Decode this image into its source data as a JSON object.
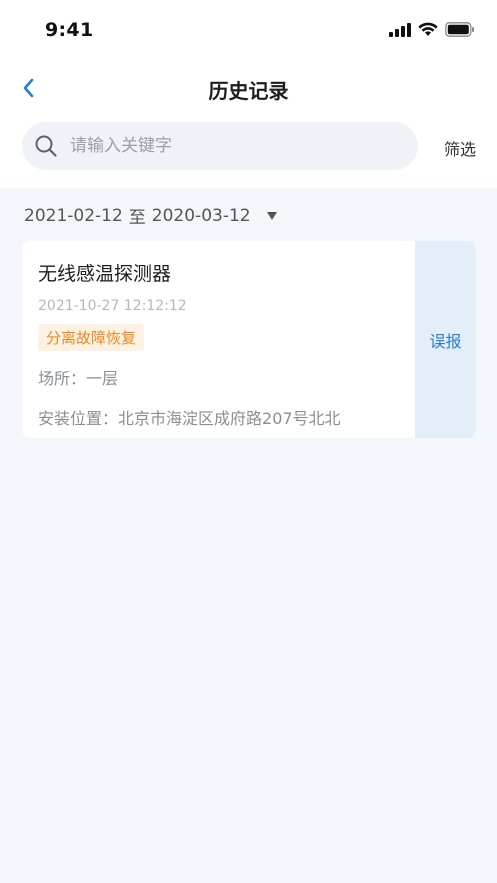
{
  "status_bar": {
    "time": "9:41"
  },
  "nav": {
    "title": "历史记录"
  },
  "search": {
    "placeholder": "请输入关键字",
    "value": ""
  },
  "filter": {
    "label": "筛选"
  },
  "date_range": {
    "start": "2021-02-12",
    "separator": "至",
    "end": "2020-03-12"
  },
  "records": [
    {
      "device_name": "无线感温探测器",
      "time": "2021-10-27 12:12:12",
      "status": "分离故障恢复",
      "place_label": "场所：",
      "place": "一层",
      "address_label": "安装位置：",
      "address": "北京市海淀区成府路207号北北",
      "action_label": "误报"
    }
  ],
  "colors": {
    "accent": "#2b7cd3",
    "badge_text": "#ef8a20",
    "badge_bg": "#fdf1e3",
    "page_bg": "#f3f6fa",
    "action_bg": "#e4eef9"
  },
  "icons": [
    "signal-icon",
    "wifi-icon",
    "battery-icon",
    "back-arrow-icon",
    "search-icon",
    "dropdown-arrow-icon"
  ]
}
